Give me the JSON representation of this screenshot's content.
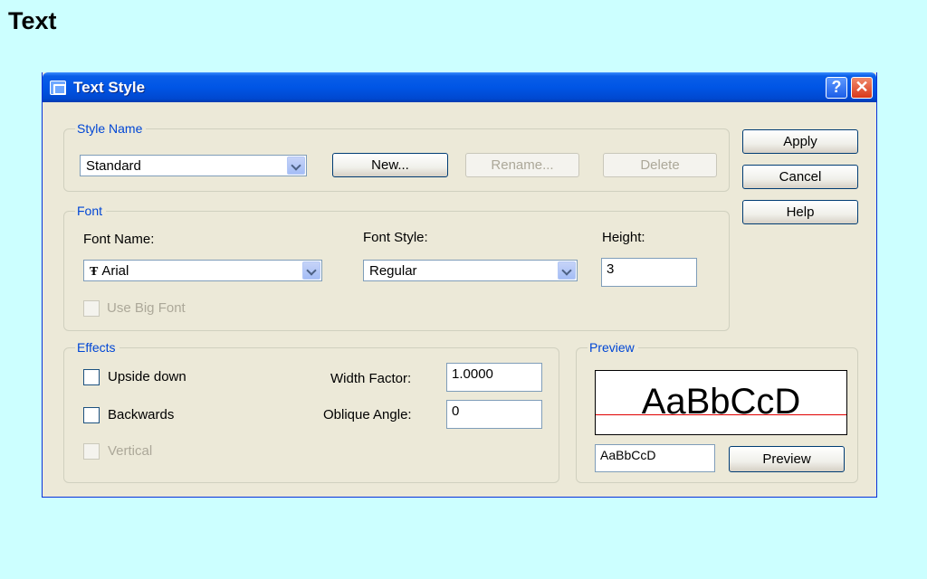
{
  "slide": {
    "title": "Text"
  },
  "window": {
    "title": "Text Style",
    "help_label": "?",
    "close_label": "✕"
  },
  "style_name": {
    "legend": "Style Name",
    "selected": "Standard",
    "new_label": "New...",
    "rename_label": "Rename...",
    "delete_label": "Delete"
  },
  "side_buttons": {
    "apply_label": "Apply",
    "cancel_label": "Cancel",
    "help_label": "Help"
  },
  "font": {
    "legend": "Font",
    "font_name_label": "Font Name:",
    "font_name_value": "Arial",
    "font_icon": "truetype-icon",
    "font_icon_glyph": "Ŧ",
    "font_style_label": "Font Style:",
    "font_style_value": "Regular",
    "height_label": "Height:",
    "height_value": "3",
    "big_font_label": "Use Big Font"
  },
  "effects": {
    "legend": "Effects",
    "upside_down_label": "Upside down",
    "backwards_label": "Backwards",
    "vertical_label": "Vertical",
    "width_factor_label": "Width Factor:",
    "width_factor_value": "1.0000",
    "oblique_angle_label": "Oblique Angle:",
    "oblique_angle_value": "0"
  },
  "preview": {
    "legend": "Preview",
    "sample_display": "AaBbCcD",
    "sample_input": "AaBbCcD",
    "button_label": "Preview"
  },
  "colors": {
    "background": "#ccffff",
    "dialog": "#ece9d8",
    "titlebar": "#0055e5",
    "legend_text": "#0046d5",
    "baseline": "#e00000"
  }
}
